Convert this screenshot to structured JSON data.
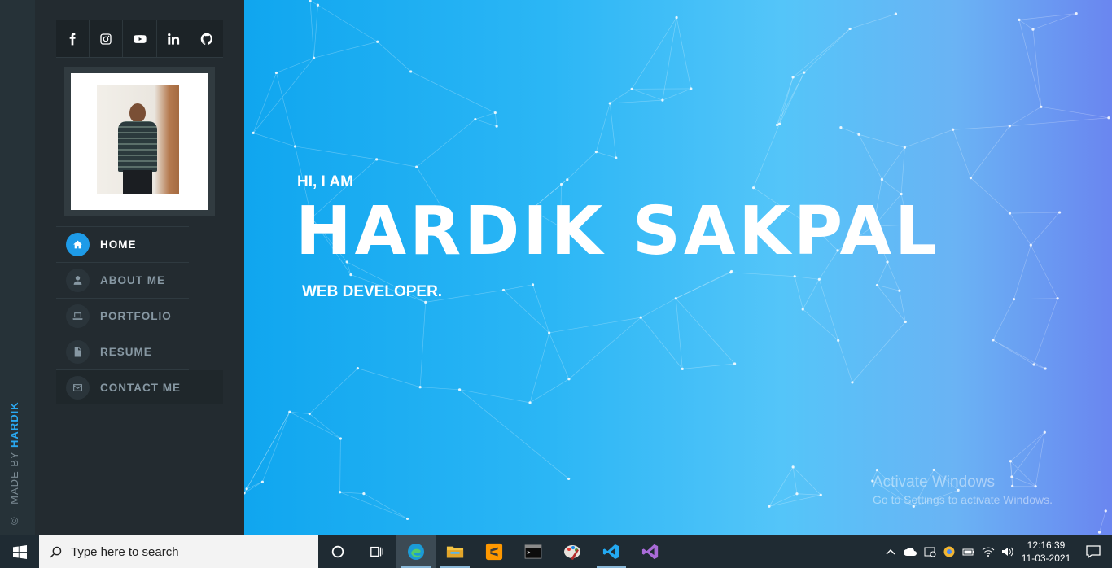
{
  "credit": {
    "prefix": "© - MADE BY ",
    "author": "HARDIK"
  },
  "social": [
    "facebook-icon",
    "instagram-icon",
    "youtube-icon",
    "linkedin-icon",
    "github-icon"
  ],
  "nav": [
    {
      "label": "HOME",
      "icon": "home-icon",
      "active": true
    },
    {
      "label": "ABOUT ME",
      "icon": "user-icon",
      "active": false
    },
    {
      "label": "PORTFOLIO",
      "icon": "laptop-icon",
      "active": false
    },
    {
      "label": "RESUME",
      "icon": "document-icon",
      "active": false
    },
    {
      "label": "CONTACT ME",
      "icon": "envelope-icon",
      "active": false
    }
  ],
  "hero": {
    "greeting": "HI, I AM",
    "name": "HARDIK SAKPAL",
    "role": "WEB DEVELOPER."
  },
  "watermark": {
    "line1": "Activate Windows",
    "line2": "Go to Settings to activate Windows."
  },
  "taskbar": {
    "search_placeholder": "Type here to search",
    "time": "12:16:39",
    "date": "11-03-2021",
    "apps": [
      "cortana-icon",
      "task-view-icon",
      "edge-icon",
      "file-explorer-icon",
      "sublime-text-icon",
      "terminal-icon",
      "paint-icon",
      "vscode-icon",
      "visual-studio-icon"
    ]
  },
  "colors": {
    "accent": "#1e9be8",
    "sidebar": "#232b30",
    "hero_start": "#10a6ef",
    "hero_end": "#6a86f0"
  }
}
